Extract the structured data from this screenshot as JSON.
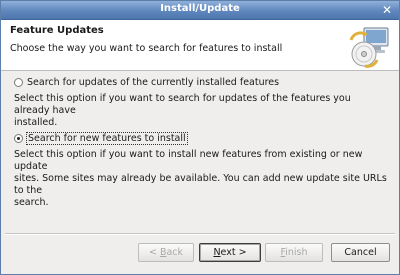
{
  "window": {
    "title": "Install/Update"
  },
  "banner": {
    "title": "Feature Updates",
    "description": "Choose the way you want to search for features to install",
    "icon": "install-wizard-icon"
  },
  "options": [
    {
      "label": "Search for updates of the currently installed features",
      "checked": false,
      "description_lines": [
        "Select this option if you want to search for updates of the features you already have",
        "installed."
      ]
    },
    {
      "label": "Search for new features to install",
      "checked": true,
      "description_lines": [
        "Select this option if you want to install new features from existing or new update",
        "sites. Some sites may already be available. You can add new update site URLs to the",
        "search."
      ]
    }
  ],
  "buttons": {
    "back": {
      "prefix": "< ",
      "mnemonic": "B",
      "rest": "ack",
      "enabled": false
    },
    "next": {
      "mnemonic": "N",
      "rest": "ext >",
      "enabled": true
    },
    "finish": {
      "mnemonic": "F",
      "rest": "inish",
      "enabled": false
    },
    "cancel": {
      "label": "Cancel",
      "enabled": true
    }
  }
}
